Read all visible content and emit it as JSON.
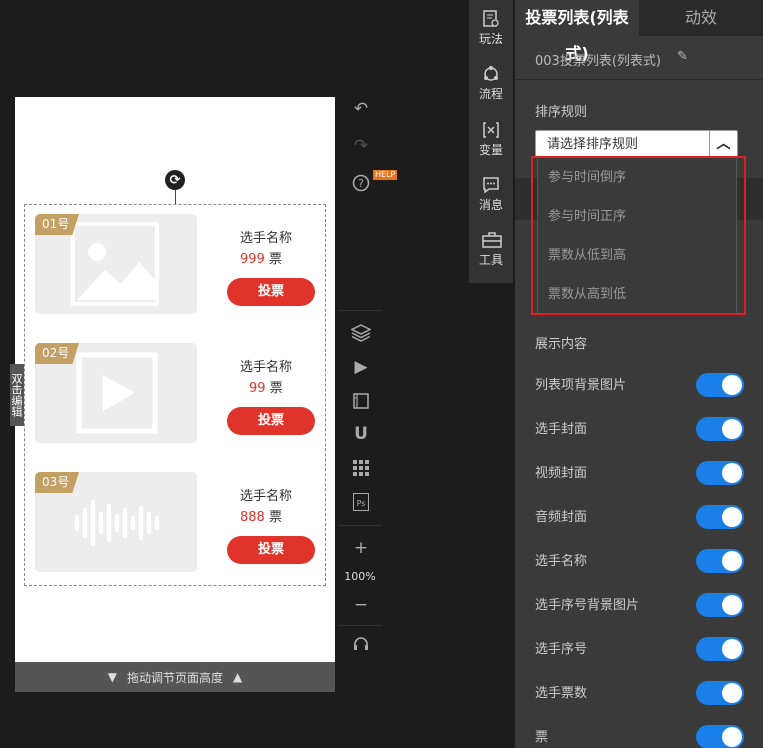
{
  "canvas": {
    "players": [
      {
        "badge": "01号",
        "name": "选手名称",
        "votes": "999",
        "unit": "票",
        "button": "投票",
        "media": "image-placeholder-icon"
      },
      {
        "badge": "02号",
        "name": "选手名称",
        "votes": "99",
        "unit": "票",
        "button": "投票",
        "media": "play-video-icon"
      },
      {
        "badge": "03号",
        "name": "选手名称",
        "votes": "888",
        "unit": "票",
        "button": "投票",
        "media": "audio-waveform-icon"
      }
    ],
    "double_click_hint": "双击编辑",
    "drag_bar_label": "拖动调节页面高度"
  },
  "toolbar": {
    "help_badge": "HELP",
    "zoom": "100%"
  },
  "rail": {
    "items": [
      {
        "label": "玩法",
        "icon": "gameplay-icon"
      },
      {
        "label": "流程",
        "icon": "flow-icon"
      },
      {
        "label": "变量",
        "icon": "variable-icon"
      },
      {
        "label": "消息",
        "icon": "message-icon"
      },
      {
        "label": "工具",
        "icon": "toolbox-icon"
      }
    ]
  },
  "panel": {
    "tabs": [
      "投票列表(列表式)",
      "动效"
    ],
    "component_name": "003投票列表(列表式)",
    "sort_label": "排序规则",
    "sort_placeholder": "请选择排序规则",
    "sort_options": [
      "参与时间倒序",
      "参与时间正序",
      "票数从低到高",
      "票数从高到低"
    ],
    "content_label": "展示内容",
    "toggles": [
      {
        "label": "列表项背景图片",
        "on": true
      },
      {
        "label": "选手封面",
        "on": true
      },
      {
        "label": "视频封面",
        "on": true
      },
      {
        "label": "音频封面",
        "on": true
      },
      {
        "label": "选手名称",
        "on": true
      },
      {
        "label": "选手序号背景图片",
        "on": true
      },
      {
        "label": "选手序号",
        "on": true
      },
      {
        "label": "选手票数",
        "on": true
      },
      {
        "label": "票",
        "on": true
      }
    ],
    "accent_color": "#1a7fe8",
    "highlight_color": "#e02020"
  }
}
